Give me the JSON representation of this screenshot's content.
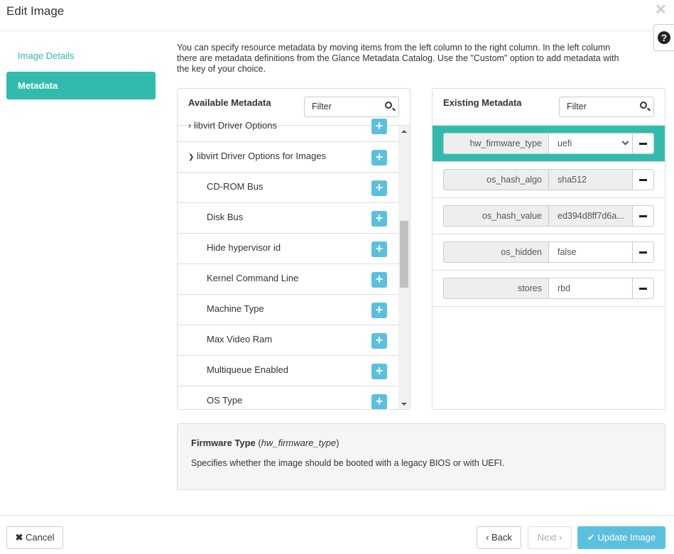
{
  "title": "Edit Image",
  "sidebar": {
    "items": [
      {
        "label": "Image Details",
        "active": false
      },
      {
        "label": "Metadata",
        "active": true
      }
    ]
  },
  "intro": "You can specify resource metadata by moving items from the left column to the right column. In the left column there are metadata definitions from the Glance Metadata Catalog. Use the \"Custom\" option to add metadata with the key of your choice.",
  "available": {
    "title": "Available Metadata",
    "filter_placeholder": "Filter",
    "items": [
      {
        "label": "libvirt Driver Options",
        "group": true,
        "expanded": false
      },
      {
        "label": "libvirt Driver Options for Images",
        "group": true,
        "expanded": true
      },
      {
        "label": "CD-ROM Bus"
      },
      {
        "label": "Disk Bus"
      },
      {
        "label": "Hide hypervisor id"
      },
      {
        "label": "Kernel Command Line"
      },
      {
        "label": "Machine Type"
      },
      {
        "label": "Max Video Ram"
      },
      {
        "label": "Multiqueue Enabled"
      },
      {
        "label": "OS Type"
      }
    ]
  },
  "existing": {
    "title": "Existing Metadata",
    "filter_placeholder": "Filter",
    "items": [
      {
        "key": "hw_firmware_type",
        "value": "uefi",
        "type": "select",
        "selected": true
      },
      {
        "key": "os_hash_algo",
        "value": "sha512",
        "readonly": true
      },
      {
        "key": "os_hash_value",
        "value": "ed394d8ff7d6a...",
        "readonly": true
      },
      {
        "key": "os_hidden",
        "value": "false"
      },
      {
        "key": "stores",
        "value": "rbd"
      }
    ]
  },
  "description": {
    "name": "Firmware Type",
    "key": "hw_firmware_type",
    "text": "Specifies whether the image should be booted with a legacy BIOS or with UEFI."
  },
  "footer": {
    "cancel": "Cancel",
    "back": "Back",
    "next": "Next",
    "update": "Update Image"
  },
  "colors": {
    "accent": "#31bbac",
    "primary": "#5bc0de"
  }
}
